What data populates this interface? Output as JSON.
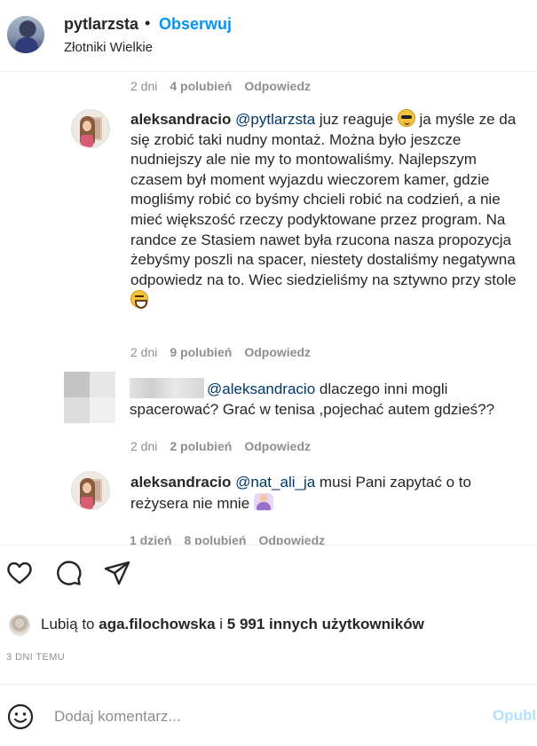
{
  "post_header": {
    "username": "pytlarzsta",
    "separator": "•",
    "follow_label": "Obserwuj",
    "location": "Złotniki Wielkie"
  },
  "comments": [
    {
      "meta": {
        "time": "2 dni",
        "likes": "4 polubień",
        "reply": "Odpowiedz"
      }
    },
    {
      "author": "aleksandracio",
      "mention": "@pytlarzsta",
      "text_before_emoji": " juz reaguje ",
      "emoji_1": "smiling-face-with-sunglasses",
      "text_after_emoji": " ja myśle ze da się zrobić taki nudny montaż. Można było jeszcze nudniejszy ale nie my to montowaliśmy. Najlepszym czasem był moment wyjazdu wieczorem kamer, gdzie mogliśmy robić co byśmy chcieli robić na codzień, a nie mieć większość rzeczy podyktowane przez program. Na randce ze Stasiem nawet była rzucona nasza propozycja żebyśmy poszli na spacer, niestety dostaliśmy negatywna odpowiedz na to. Wiec siedzieliśmy na sztywno przy stole ",
      "emoji_2": "face-with-tears-of-joy",
      "meta": {
        "time": "2 dni",
        "likes": "9 polubień",
        "reply": "Odpowiedz"
      }
    },
    {
      "author_hidden": true,
      "mention": "@aleksandracio",
      "text": " dlaczego inni mogli spacerować? Grać w tenisa ,pojechać autem gdzieś??",
      "meta": {
        "time": "2 dni",
        "likes": "2 polubień",
        "reply": "Odpowiedz"
      }
    },
    {
      "author": "aleksandracio",
      "mention": "@nat_ali_ja",
      "text": " musi Pani zapytać o to reżysera nie mnie ",
      "emoji": "person-shrugging",
      "meta": {
        "time": "1 dzień",
        "likes": "8 polubień",
        "reply": "Odpowiedz"
      }
    }
  ],
  "actions": {
    "icons": [
      "heart-icon",
      "comment-icon",
      "share-icon"
    ]
  },
  "likes": {
    "prefix": "Lubią to ",
    "user": "aga.filochowska",
    "middle": " i ",
    "count_text": "5 991 innych użytkowników"
  },
  "post_date": "3 DNI TEMU",
  "comment_box": {
    "placeholder": "Dodaj komentarz...",
    "publish_label": "Opublikuj"
  },
  "colors": {
    "accent": "#0095f6",
    "mention": "#00376b",
    "muted": "#8e8e8e",
    "publish_disabled": "#b2dffc"
  }
}
